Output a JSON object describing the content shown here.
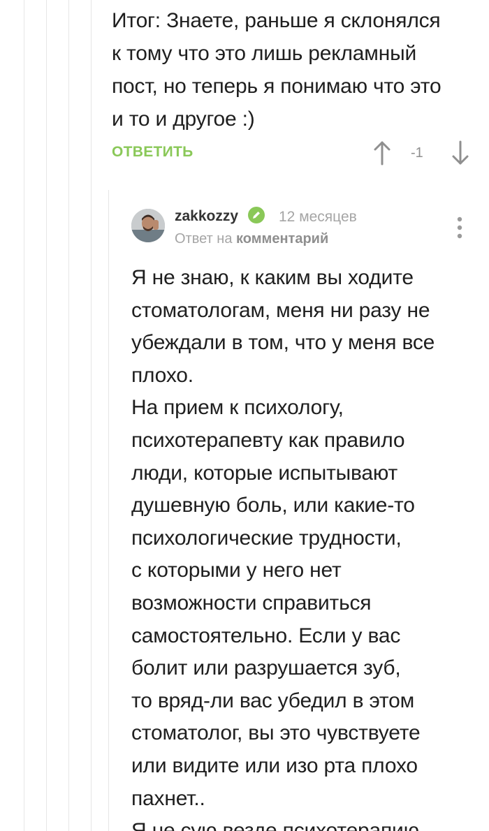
{
  "parent_comment": {
    "text": "Итог: Знаете, раньше я склонялся\nк тому что это лишь рекламный\nпост, но теперь я понимаю что это\nи то и другое :)",
    "reply_label": "ОТВЕТИТЬ",
    "rating": "-1",
    "upvote_icon": "arrow-up-icon",
    "downvote_icon": "arrow-down-icon"
  },
  "reply_comment": {
    "username": "zakkozzy",
    "verified_icon": "verified-pencil-icon",
    "timestamp": "12 месяцев",
    "reply_to_prefix": "Ответ на",
    "reply_to_link": "комментарий",
    "more_icon": "more-vertical-icon",
    "text": "Я не знаю, к каким вы ходите\nстоматологам, меня ни разу не\nубеждали в том, что у меня все\nплохо.\nНа прием к психологу,\nпсихотерапевту как правило\nлюди, которые испытывают\nдушевную боль, или какие-то\nпсихологические трудности,\nс которыми у него нет\nвозможности справиться\nсамостоятельно. Если у вас\nболит или разрушается зуб,\nто вряд-ли вас убедил в этом\nстоматолог, вы это чувствуете\nили видите или изо рта плохо\nпахнет..\nЯ не сую везде психотерапию"
  },
  "colors": {
    "accent_green": "#8ac858",
    "muted_text": "#a5a5a5",
    "thread_line": "#e6e6e6"
  }
}
